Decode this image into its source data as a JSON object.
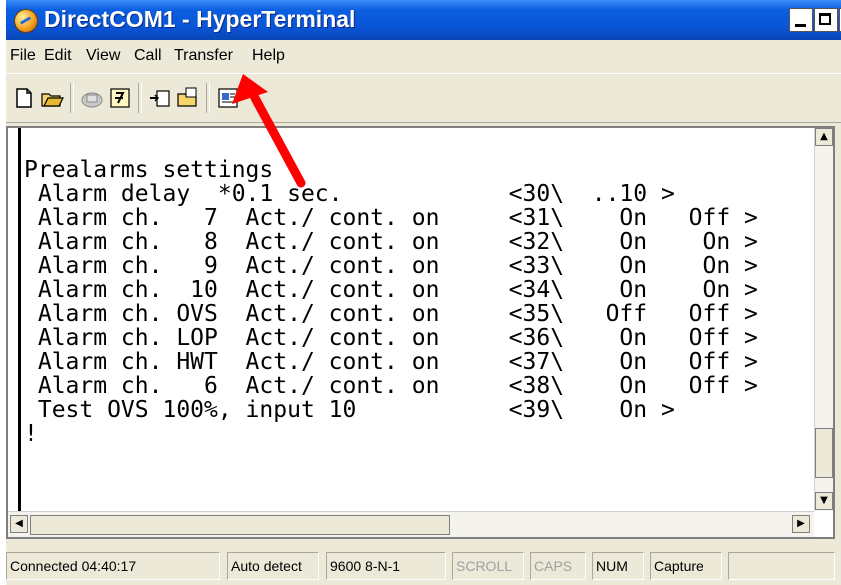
{
  "window": {
    "title": "DirectCOM1 - HyperTerminal"
  },
  "menu": [
    "File",
    "Edit",
    "View",
    "Call",
    "Transfer",
    "Help"
  ],
  "toolbar": {
    "buttons": [
      "new-icon",
      "open-icon",
      "phone-icon",
      "disconnect-icon",
      "send-icon",
      "receive-icon",
      "properties-icon"
    ]
  },
  "terminal": {
    "lines": [
      "Prealarms settings",
      " Alarm delay  *0.1 sec.            <30\\  ..10 >",
      " Alarm ch.   7  Act./ cont. on     <31\\    On   Off >",
      " Alarm ch.   8  Act./ cont. on     <32\\    On    On >",
      " Alarm ch.   9  Act./ cont. on     <33\\    On    On >",
      " Alarm ch.  10  Act./ cont. on     <34\\    On    On >",
      " Alarm ch. OVS  Act./ cont. on     <35\\   Off   Off >",
      " Alarm ch. LOP  Act./ cont. on     <36\\    On   Off >",
      " Alarm ch. HWT  Act./ cont. on     <37\\    On   Off >",
      " Alarm ch.   6  Act./ cont. on     <38\\    On   Off >",
      " Test OVS 100%, input 10           <39\\    On >",
      "!"
    ]
  },
  "status": {
    "connected": "Connected 04:40:17",
    "detect": "Auto detect",
    "port": "9600 8-N-1",
    "scroll": "SCROLL",
    "caps": "CAPS",
    "num": "NUM",
    "capture": "Capture"
  },
  "colors": {
    "title_bar": "#0a54d6",
    "annotation_arrow": "#ff0000"
  }
}
